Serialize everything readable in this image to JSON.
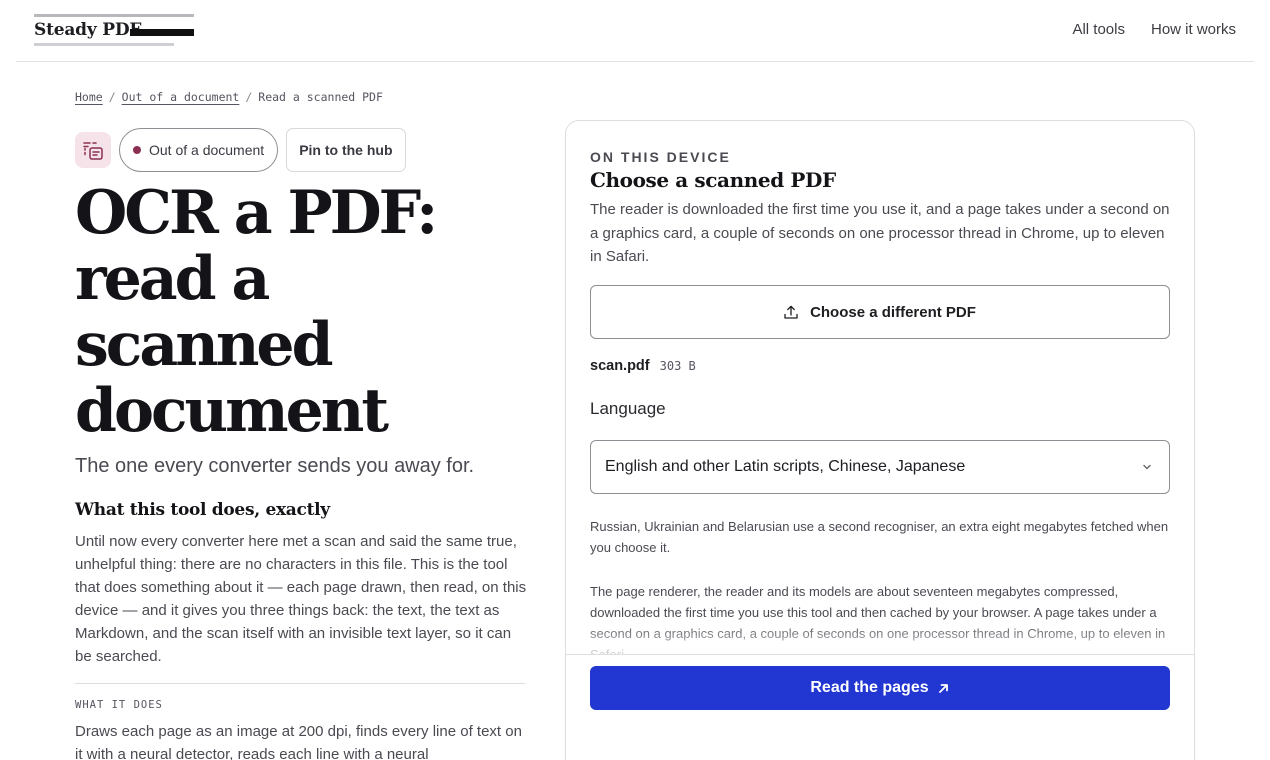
{
  "header": {
    "logo_text": "Steady PDF",
    "nav": [
      "All tools",
      "How it works"
    ]
  },
  "breadcrumb": {
    "items": [
      "Home",
      "Out of a document",
      "Read a scanned PDF"
    ],
    "separator": "/"
  },
  "hero": {
    "category_pill": "Out of a document",
    "pin_button": "Pin to the hub",
    "title": "OCR a PDF: read a scanned document",
    "subtitle": "The one every converter sends you away for.",
    "section_heading": "What this tool does, exactly",
    "paragraph": "Until now every converter here met a scan and said the same true, unhelpful thing: there are no characters in this file. This is the tool that does something about it — each page drawn, then read, on this device — and it gives you three things back: the text, the text as Markdown, and the scan itself with an invisible text layer, so it can be searched.",
    "what_it_does_label": "WHAT IT DOES",
    "what_it_does_text": "Draws each page as an image at 200 dpi, finds every line of text on it with a neural detector, reads each line with a neural"
  },
  "panel": {
    "eyebrow": "ON THIS DEVICE",
    "title": "Choose a scanned PDF",
    "description": "The reader is downloaded the first time you use it, and a page takes under a second on a graphics card, a couple of seconds on one processor thread in Chrome, up to eleven in Safari.",
    "choose_button": "Choose a different PDF",
    "file_name": "scan.pdf",
    "file_size": "303 B",
    "language_label": "Language",
    "language_selected": "English and other Latin scripts, Chinese, Japanese",
    "note_1": "Russian, Ukrainian and Belarusian use a second recogniser, an extra eight megabytes fetched when you choose it.",
    "note_2": "The page renderer, the reader and its models are about seventeen megabytes compressed, downloaded the first time you use this tool and then cached by your browser. A page takes under a second on a graphics card, a couple of seconds on one processor thread in Chrome, up to eleven in Safari.",
    "cta": "Read the pages"
  },
  "colors": {
    "accent": "#2236d2",
    "brand_dot": "#8a2f52",
    "icon_chip_bg": "#f6e3ea"
  },
  "icons": [
    "ocr-tool-icon",
    "upload-icon",
    "chevron-down-icon",
    "arrow-up-right-icon"
  ]
}
